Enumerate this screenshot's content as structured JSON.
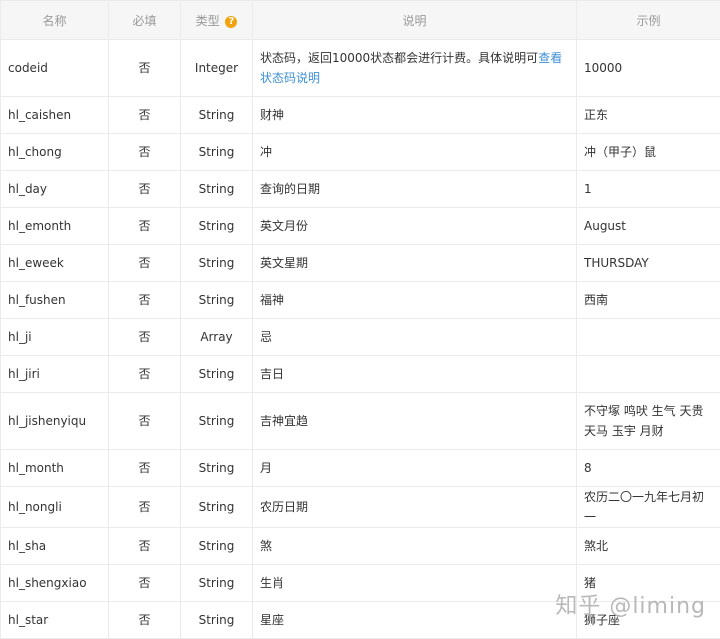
{
  "headers": {
    "name": "名称",
    "required": "必填",
    "type": "类型",
    "type_help_icon": "?",
    "desc": "说明",
    "example": "示例"
  },
  "rows": [
    {
      "name": "codeid",
      "required": "否",
      "type": "Integer",
      "desc": "状态码，返回10000状态都会进行计费。具体说明可",
      "desc_link": "查看状态码说明",
      "example": "10000"
    },
    {
      "name": "hl_caishen",
      "required": "否",
      "type": "String",
      "desc": "财神",
      "example": "正东"
    },
    {
      "name": "hl_chong",
      "required": "否",
      "type": "String",
      "desc": "冲",
      "example": "冲（甲子）鼠"
    },
    {
      "name": "hl_day",
      "required": "否",
      "type": "String",
      "desc": "查询的日期",
      "example": "1"
    },
    {
      "name": "hl_emonth",
      "required": "否",
      "type": "String",
      "desc": "英文月份",
      "example": "August"
    },
    {
      "name": "hl_eweek",
      "required": "否",
      "type": "String",
      "desc": "英文星期",
      "example": "THURSDAY"
    },
    {
      "name": "hl_fushen",
      "required": "否",
      "type": "String",
      "desc": "福神",
      "example": "西南"
    },
    {
      "name": "hl_ji",
      "required": "否",
      "type": "Array",
      "desc": "忌",
      "example": ""
    },
    {
      "name": "hl_jiri",
      "required": "否",
      "type": "String",
      "desc": "吉日",
      "example": ""
    },
    {
      "name": "hl_jishenyiqu",
      "required": "否",
      "type": "String",
      "desc": "吉神宜趋",
      "example": "不守塚 鸣吠 生气 天贵 天马 玉宇 月财"
    },
    {
      "name": "hl_month",
      "required": "否",
      "type": "String",
      "desc": "月",
      "example": "8"
    },
    {
      "name": "hl_nongli",
      "required": "否",
      "type": "String",
      "desc": "农历日期",
      "example": "农历二〇一九年七月初一"
    },
    {
      "name": "hl_sha",
      "required": "否",
      "type": "String",
      "desc": "煞",
      "example": "煞北"
    },
    {
      "name": "hl_shengxiao",
      "required": "否",
      "type": "String",
      "desc": "生肖",
      "example": "猪"
    },
    {
      "name": "hl_star",
      "required": "否",
      "type": "String",
      "desc": "星座",
      "example": "狮子座"
    }
  ],
  "watermark": "知乎 @liming"
}
